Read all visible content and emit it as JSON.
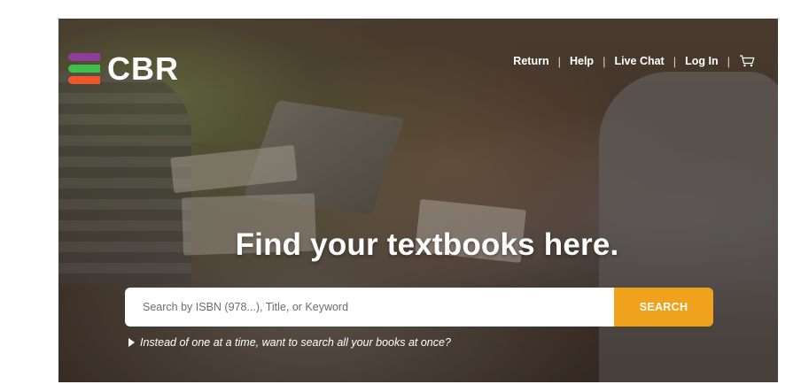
{
  "brand": {
    "name": "CBR",
    "logo_colors": [
      "#8e3d9a",
      "#3fbf4e",
      "#f1562a"
    ]
  },
  "topnav": {
    "items": [
      {
        "label": "Return"
      },
      {
        "label": "Help"
      },
      {
        "label": "Live Chat"
      },
      {
        "label": "Log In"
      }
    ],
    "separator": "|",
    "cart_icon": "cart-icon"
  },
  "hero": {
    "headline": "Find your textbooks here."
  },
  "search": {
    "placeholder": "Search by ISBN (978...), Title, or Keyword",
    "value": "",
    "button_label": "SEARCH",
    "button_color": "#f0a21c"
  },
  "bulk_search": {
    "label": "Instead of one at a time, want to search all your books at once?",
    "icon": "caret-right-icon"
  }
}
